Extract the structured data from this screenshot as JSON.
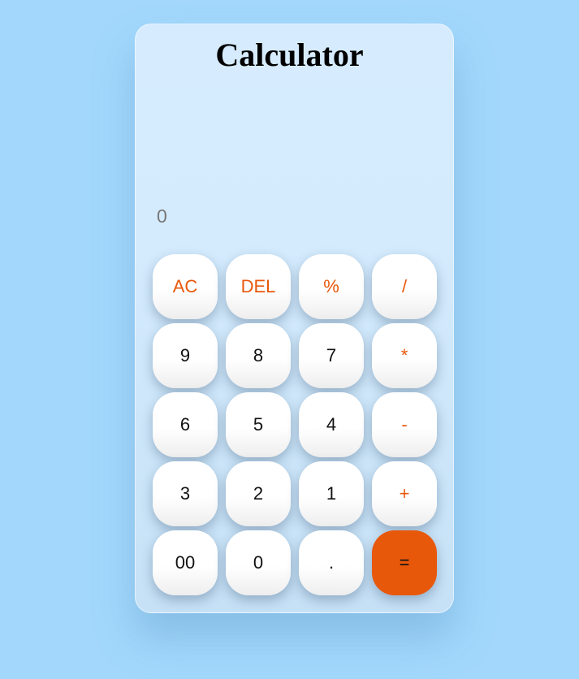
{
  "title": "Calculator",
  "display": {
    "value": "0"
  },
  "keys": [
    {
      "label": "AC",
      "name": "all-clear-button",
      "kind": "op"
    },
    {
      "label": "DEL",
      "name": "delete-button",
      "kind": "op"
    },
    {
      "label": "%",
      "name": "percent-button",
      "kind": "op"
    },
    {
      "label": "/",
      "name": "divide-button",
      "kind": "op"
    },
    {
      "label": "9",
      "name": "digit-9-button",
      "kind": "num"
    },
    {
      "label": "8",
      "name": "digit-8-button",
      "kind": "num"
    },
    {
      "label": "7",
      "name": "digit-7-button",
      "kind": "num"
    },
    {
      "label": "*",
      "name": "multiply-button",
      "kind": "op"
    },
    {
      "label": "6",
      "name": "digit-6-button",
      "kind": "num"
    },
    {
      "label": "5",
      "name": "digit-5-button",
      "kind": "num"
    },
    {
      "label": "4",
      "name": "digit-4-button",
      "kind": "num"
    },
    {
      "label": "-",
      "name": "subtract-button",
      "kind": "op"
    },
    {
      "label": "3",
      "name": "digit-3-button",
      "kind": "num"
    },
    {
      "label": "2",
      "name": "digit-2-button",
      "kind": "num"
    },
    {
      "label": "1",
      "name": "digit-1-button",
      "kind": "num"
    },
    {
      "label": "+",
      "name": "add-button",
      "kind": "op"
    },
    {
      "label": "00",
      "name": "double-zero-button",
      "kind": "num"
    },
    {
      "label": "0",
      "name": "digit-0-button",
      "kind": "num"
    },
    {
      "label": ".",
      "name": "decimal-point-button",
      "kind": "num"
    },
    {
      "label": "=",
      "name": "equals-button",
      "kind": "equals"
    }
  ],
  "colors": {
    "page_background": "#a3d8fc",
    "accent": "#e8580b",
    "panel": "#d6ecfe"
  }
}
